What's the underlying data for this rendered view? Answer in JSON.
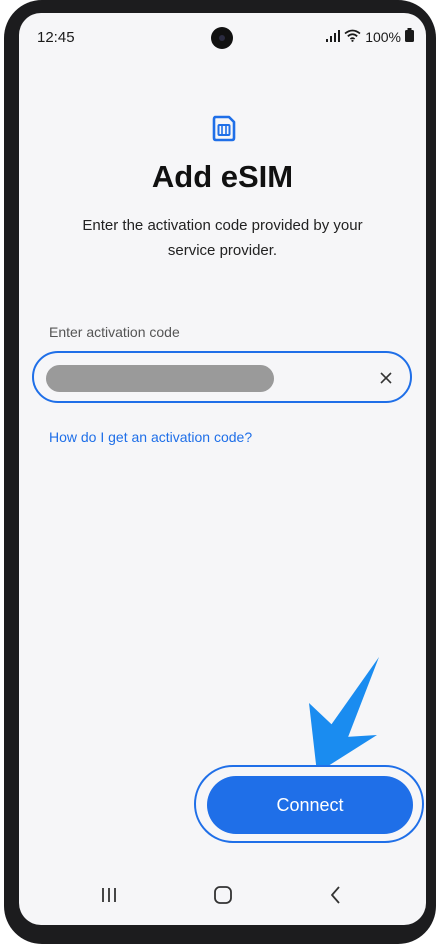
{
  "status_bar": {
    "time": "12:45",
    "battery": "100%"
  },
  "header": {
    "icon": "sim-card-icon",
    "title": "Add eSIM",
    "subtitle": "Enter the activation code provided by your service provider."
  },
  "activation": {
    "label": "Enter activation code",
    "value_masked": true,
    "clear_icon": "close-icon"
  },
  "help_link": "How do I get an activation code?",
  "connect_button": {
    "label": "Connect"
  },
  "nav_bar": {
    "items": [
      "recents-icon",
      "home-icon",
      "back-icon"
    ]
  },
  "colors": {
    "accent": "#1f6fe8",
    "arrow": "#1a8cf0",
    "background": "#f6f6f8"
  }
}
